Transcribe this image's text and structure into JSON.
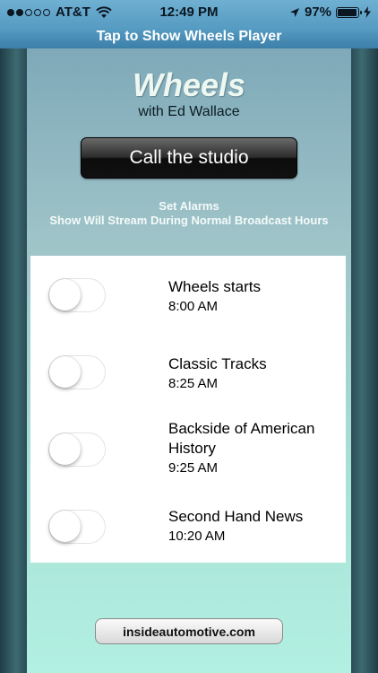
{
  "status_bar": {
    "carrier": "AT&T",
    "signal_bars_filled": 2,
    "signal_bars_total": 5,
    "time": "12:49 PM",
    "battery_percent_label": "97%",
    "battery_level": 0.97,
    "icons": [
      "wifi-icon",
      "location-arrow-icon",
      "battery-icon",
      "charging-bolt-icon"
    ]
  },
  "player_banner": {
    "label": "Tap to Show Wheels Player"
  },
  "show": {
    "title": "Wheels",
    "host": "with Ed Wallace"
  },
  "call_button": {
    "label": "Call the studio"
  },
  "alarms": {
    "heading_line1": "Set Alarms",
    "heading_line2": "Show Will Stream During Normal Broadcast Hours",
    "items": [
      {
        "name": "Wheels starts",
        "time": "8:00 AM",
        "enabled": false
      },
      {
        "name": "Classic Tracks",
        "time": "8:25 AM",
        "enabled": false
      },
      {
        "name": "Backside of American History",
        "time": "9:25 AM",
        "enabled": false
      },
      {
        "name": "Second Hand News",
        "time": "10:20 AM",
        "enabled": false
      }
    ]
  },
  "website_button": {
    "label": "insideautomotive.com"
  },
  "colors": {
    "status_bar": "#6fb0d2",
    "banner": "#3c7fa9",
    "panel_top": "#7fa9b9",
    "panel_bottom": "#b2f0e2",
    "call_button": "#111111"
  }
}
